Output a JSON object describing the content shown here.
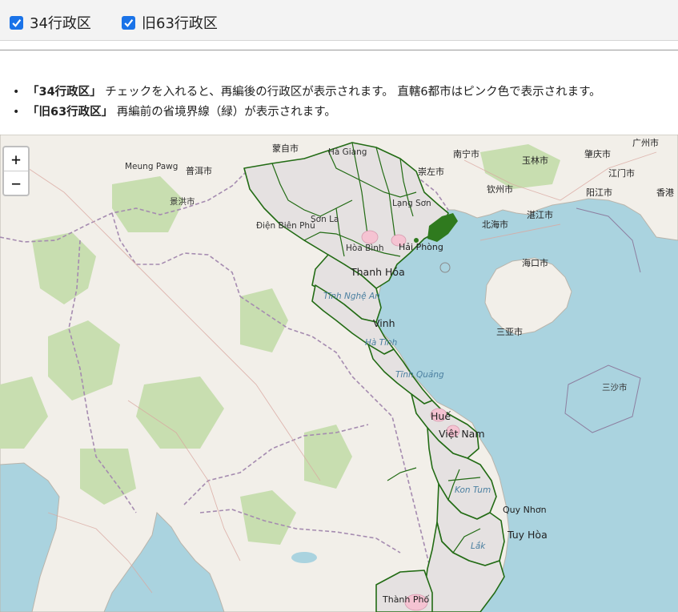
{
  "controls": {
    "layer_34": {
      "label": "34行政区",
      "checked": true
    },
    "layer_63": {
      "label": "旧63行政区",
      "checked": true
    }
  },
  "notes": [
    {
      "bold": "「34行政区」",
      "text": " チェックを入れると、再編後の行政区が表示されます。 直轄6都市はピンク色で表示されます。"
    },
    {
      "bold": "「旧63行政区」",
      "text": " 再編前の省境界線（緑）が表示されます。"
    }
  ],
  "zoom": {
    "in": "+",
    "out": "−"
  },
  "map_labels": [
    {
      "text": "蒙自市"
    },
    {
      "text": "南宁市"
    },
    {
      "text": "肇庆市"
    },
    {
      "text": "广州市"
    },
    {
      "text": "江门市"
    },
    {
      "text": "香港"
    },
    {
      "text": "北海市"
    },
    {
      "text": "海口市"
    },
    {
      "text": "三亚市"
    },
    {
      "text": "三沙市"
    },
    {
      "text": "崇左市"
    },
    {
      "text": "钦州市"
    },
    {
      "text": "湛江市"
    },
    {
      "text": "玉林市"
    },
    {
      "text": "阳江市"
    },
    {
      "text": "普洱市"
    },
    {
      "text": "Thanh Hóa"
    },
    {
      "text": "Vinh"
    },
    {
      "text": "Huế"
    },
    {
      "text": "Việt Nam"
    },
    {
      "text": "Quy Nhơn"
    },
    {
      "text": "Tuy Hòa"
    },
    {
      "text": "Hải Phòng"
    },
    {
      "text": "Hà Giang"
    },
    {
      "text": "Lạng Sơn"
    },
    {
      "text": "Sơn La"
    },
    {
      "text": "Hòa Bình"
    },
    {
      "text": "Tĩnh Nghệ An"
    },
    {
      "text": "Hà Tĩnh"
    },
    {
      "text": "Tĩnh Quảng"
    },
    {
      "text": "Kon Tum"
    },
    {
      "text": "Lắk"
    },
    {
      "text": "Thành Phố"
    },
    {
      "text": "Điện Biên Phủ"
    },
    {
      "text": "Meung Pawg"
    },
    {
      "text": "景洪市"
    }
  ],
  "colors": {
    "land": "#f2efe9",
    "water": "#aad3df",
    "forest": "#c8deb0",
    "province_fill": "#e4e0e0",
    "border_green": "#1f6b12",
    "city_pink": "#f7c9d6",
    "accent": "#1a73e8"
  }
}
